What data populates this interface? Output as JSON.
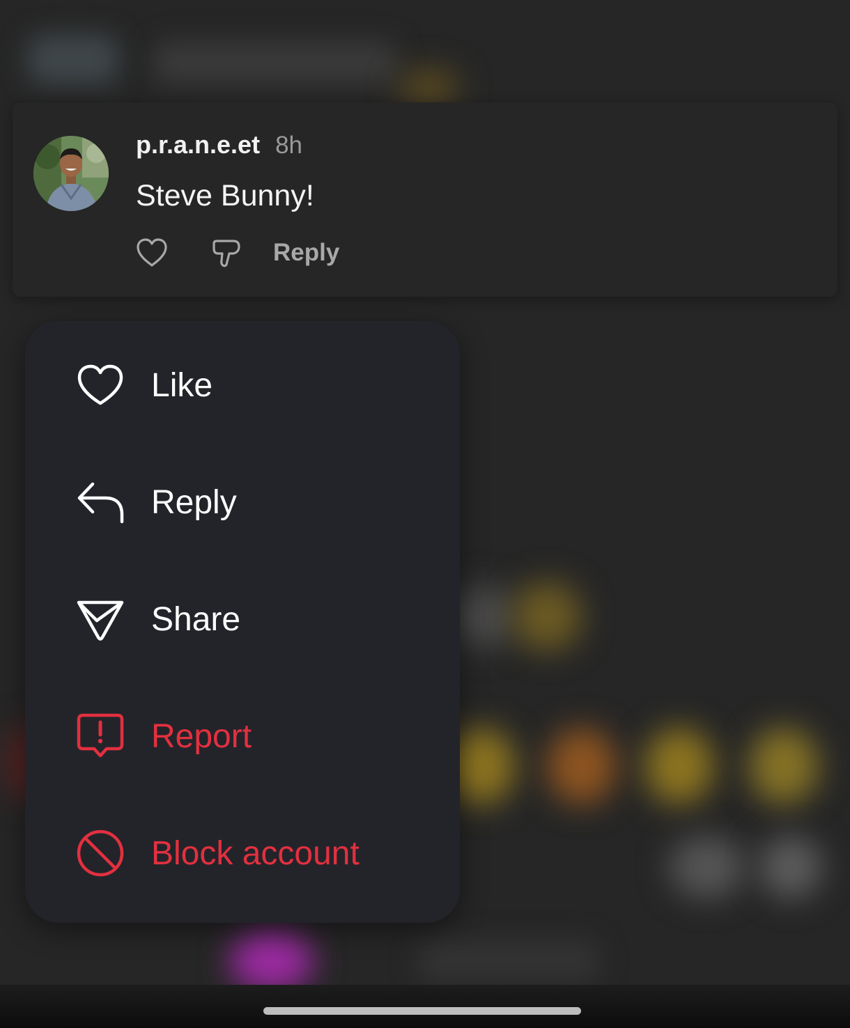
{
  "comment": {
    "username": "p.r.a.n.e.et",
    "timestamp": "8h",
    "text": "Steve Bunny!",
    "reply_label": "Reply"
  },
  "menu": {
    "items": [
      {
        "label": "Like",
        "icon": "heart-icon",
        "danger": false
      },
      {
        "label": "Reply",
        "icon": "reply-arrow-icon",
        "danger": false
      },
      {
        "label": "Share",
        "icon": "paper-plane-icon",
        "danger": false
      },
      {
        "label": "Report",
        "icon": "report-alert-icon",
        "danger": true
      },
      {
        "label": "Block account",
        "icon": "block-icon",
        "danger": true
      }
    ]
  },
  "colors": {
    "background": "#262626",
    "menu_background": "#23242a",
    "danger": "#e3303f",
    "text_primary": "#ffffff",
    "text_secondary": "#9a9a9a"
  }
}
